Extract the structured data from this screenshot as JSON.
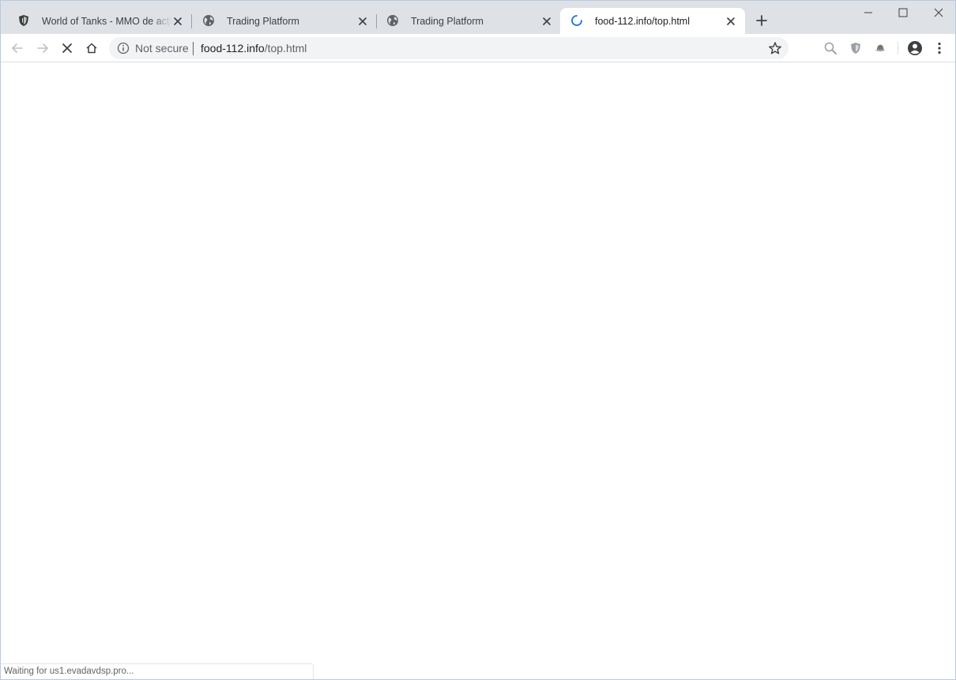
{
  "tabs": [
    {
      "title": "World of Tanks - MMO de acțiune",
      "icon": "world-of-tanks-shield-icon"
    },
    {
      "title": "Trading Platform",
      "icon": "globe-icon"
    },
    {
      "title": "Trading Platform",
      "icon": "globe-icon"
    },
    {
      "title": "food-112.info/top.html",
      "icon": "loading-spinner-icon",
      "active": true
    }
  ],
  "omnibox": {
    "security_label": "Not secure",
    "url_host": "food-112.info",
    "url_path": "/top.html"
  },
  "status": {
    "text": "Waiting for us1.evadavdsp.pro..."
  },
  "colors": {
    "tabstrip": "#dee1e6",
    "omnibox": "#f1f3f4",
    "spinner": "#1a73e8"
  }
}
